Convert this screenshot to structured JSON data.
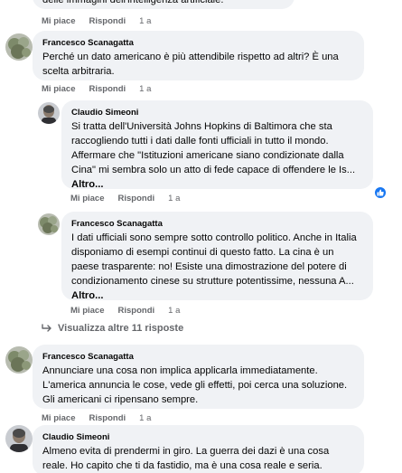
{
  "top_fragment": {
    "text": "delle immagini dell'intelligenza artificiale.",
    "actions": {
      "like": "Mi piace",
      "reply": "Rispondi",
      "time": "1 a"
    }
  },
  "comments": [
    {
      "author": "Francesco Scanagatta",
      "text": "Perché un dato americano è più attendibile rispetto ad altri? È una scelta arbitraria.",
      "actions": {
        "like": "Mi piace",
        "reply": "Rispondi",
        "time": "1 a"
      }
    }
  ],
  "replies": [
    {
      "author": "Claudio Simeoni",
      "text": "Si tratta dell'Università Johns Hopkins di Baltimora che sta raccogliendo tutti i dati dalle fonti ufficiali in tutto il mondo. Affermare che \"Istituzioni americane siano condizionate dalla Cina\" mi sembra solo un atto di fede capace di offendere le Is...",
      "more": "Altro...",
      "actions": {
        "like": "Mi piace",
        "reply": "Rispondi",
        "time": "1 a"
      },
      "reaction_count": ""
    },
    {
      "author": "Francesco Scanagatta",
      "text": "I dati ufficiali sono sempre sotto controllo politico. Anche in Italia disponiamo di esempi continui di questo fatto. La cina è un paese trasparente: no! Esiste una dimostrazione del potere di condizionamento cinese su strutture potentissime, nessuna A...",
      "more": "Altro...",
      "actions": {
        "like": "Mi piace",
        "reply": "Rispondi",
        "time": "1 a"
      }
    }
  ],
  "view_more": "Visualizza altre 11 risposte",
  "comments_bottom": [
    {
      "author": "Francesco Scanagatta",
      "text": "Annunciare una cosa non implica applicarla immediatamente. L'america annuncia le cose, vede gli effetti, poi cerca una soluzione. Gli americani ci ripensano sempre.",
      "actions": {
        "like": "Mi piace",
        "reply": "Rispondi",
        "time": "1 a"
      }
    },
    {
      "author": "Claudio Simeoni",
      "text": "Almeno evita di prendermi in giro. La guerra dei dazi è una cosa reale. Ho capito che ti da fastidio, ma è una cosa reale e seria."
    }
  ],
  "colors": {
    "bubble": "#f0f2f5",
    "meta": "#65676b",
    "like_blue": "#1877f2"
  },
  "icons": [
    "reply-arrow-icon",
    "like-thumb-icon"
  ]
}
